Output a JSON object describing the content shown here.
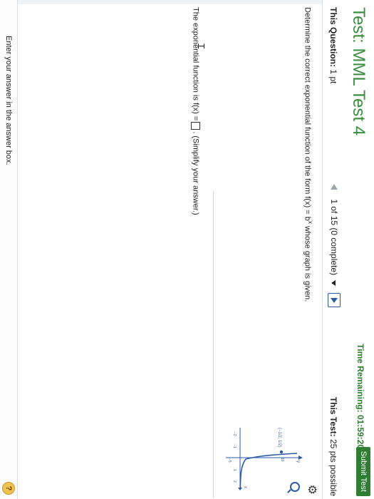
{
  "header": {
    "title": "Test: MML Test 4",
    "time_label": "Time Remaining:",
    "time_value": "01:59:20",
    "submit_label": "Submit Test"
  },
  "subheader": {
    "question_label": "This Question:",
    "question_points": "1 pt",
    "progress": "1 of 15 (0 complete)",
    "test_label": "This Test:",
    "test_points": "25 pts possible"
  },
  "question": {
    "prompt_before": "Determine the correct exponential function of the form f(x) = b",
    "prompt_sup": "x",
    "prompt_after": " whose graph is given.",
    "point_label": "(−1/2, 1/2)",
    "y_tick": "10",
    "y_tick_neg": "−5",
    "x_ticks": [
      "−2",
      "−1",
      "1",
      "2"
    ],
    "axis_x": "x",
    "axis_y": "y"
  },
  "answer": {
    "before": "The exponential function is f(x) =",
    "after": ". (Simplify your answer.)"
  },
  "footer": {
    "message": "Enter your answer in the answer box.",
    "help": "?"
  },
  "icons": {
    "gear": "gear-icon",
    "zoom": "zoom-icon",
    "help": "help-icon"
  },
  "colors": {
    "title": "#3b8d3f",
    "submit": "#2e7d32",
    "accent": "#2b5aa8"
  }
}
